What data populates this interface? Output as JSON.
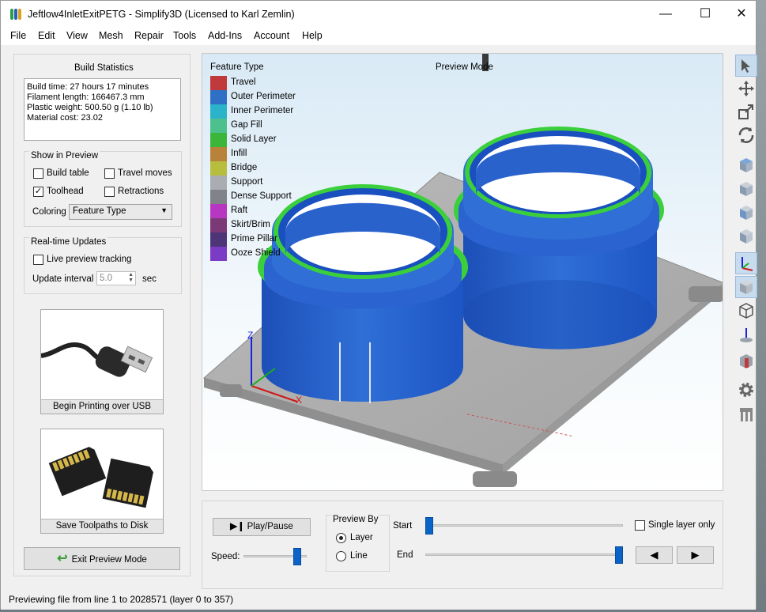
{
  "window": {
    "title": "Jeftlow4InletExitPETG - Simplify3D (Licensed to Karl Zemlin)",
    "controls": {
      "minimize": "—",
      "maximize": "☐",
      "close": "✕"
    }
  },
  "menu": [
    "File",
    "Edit",
    "View",
    "Mesh",
    "Repair",
    "Tools",
    "Add-Ins",
    "Account",
    "Help"
  ],
  "build_statistics": {
    "title": "Build Statistics",
    "lines": [
      "Build time: 27 hours 17 minutes",
      "Filament length: 166467.3 mm",
      "Plastic weight: 500.50 g (1.10 lb)",
      "Material cost: 23.02"
    ]
  },
  "show_in_preview": {
    "title": "Show in Preview",
    "build_table": {
      "label": "Build table",
      "checked": false
    },
    "travel_moves": {
      "label": "Travel moves",
      "checked": false
    },
    "toolhead": {
      "label": "Toolhead",
      "checked": true,
      "mark": "✓"
    },
    "retractions": {
      "label": "Retractions",
      "checked": false
    },
    "coloring_label": "Coloring",
    "coloring_value": "Feature Type"
  },
  "realtime": {
    "title": "Real-time Updates",
    "live_preview": {
      "label": "Live preview tracking",
      "checked": false
    },
    "interval_label": "Update interval",
    "interval_value": "5.0",
    "interval_unit": "sec"
  },
  "usb_card": {
    "caption": "Begin Printing over USB"
  },
  "sd_card": {
    "caption": "Save Toolpaths to Disk"
  },
  "exit_button": {
    "label": "Exit Preview Mode"
  },
  "viewport": {
    "legend_title": "Feature Type",
    "mode_label": "Preview Mode",
    "legend": [
      {
        "label": "Travel",
        "color": "#c0393b"
      },
      {
        "label": "Outer Perimeter",
        "color": "#2f6fc6"
      },
      {
        "label": "Inner Perimeter",
        "color": "#2bb3c9"
      },
      {
        "label": "Gap Fill",
        "color": "#4cc18e"
      },
      {
        "label": "Solid Layer",
        "color": "#3bb63b"
      },
      {
        "label": "Infill",
        "color": "#b8823a"
      },
      {
        "label": "Bridge",
        "color": "#b7bd3c"
      },
      {
        "label": "Support",
        "color": "#a9adb1"
      },
      {
        "label": "Dense Support",
        "color": "#808488"
      },
      {
        "label": "Raft",
        "color": "#b737c2"
      },
      {
        "label": "Skirt/Brim",
        "color": "#7b3a76"
      },
      {
        "label": "Prime Pillar",
        "color": "#4e3578"
      },
      {
        "label": "Ooze Shield",
        "color": "#7c3bc4"
      }
    ],
    "axis_labels": {
      "z": "Z",
      "x": "X"
    }
  },
  "playback": {
    "play_label": "Play/Pause",
    "speed_label": "Speed:",
    "speed_value": 0.9,
    "preview_by_title": "Preview By",
    "layer_label": "Layer",
    "line_label": "Line",
    "preview_by": "Layer",
    "start_label": "Start",
    "end_label": "End",
    "start_value": 0,
    "end_value": 357,
    "single_layer": {
      "label": "Single layer only",
      "checked": false
    },
    "prev_glyph": "◀",
    "next_glyph": "▶"
  },
  "toolbar": [
    "select-icon",
    "move-icon",
    "scale-icon",
    "rotate-icon",
    "view-top-icon",
    "view-bottom-icon",
    "view-front-icon",
    "view-back-icon",
    "axes-icon",
    "solid-view-icon",
    "wireframe-view-icon",
    "normals-icon",
    "cross-section-icon",
    "settings-icon",
    "support-icon"
  ],
  "status": {
    "text": "Previewing file from line 1 to 2028571 (layer 0 to 357)"
  }
}
